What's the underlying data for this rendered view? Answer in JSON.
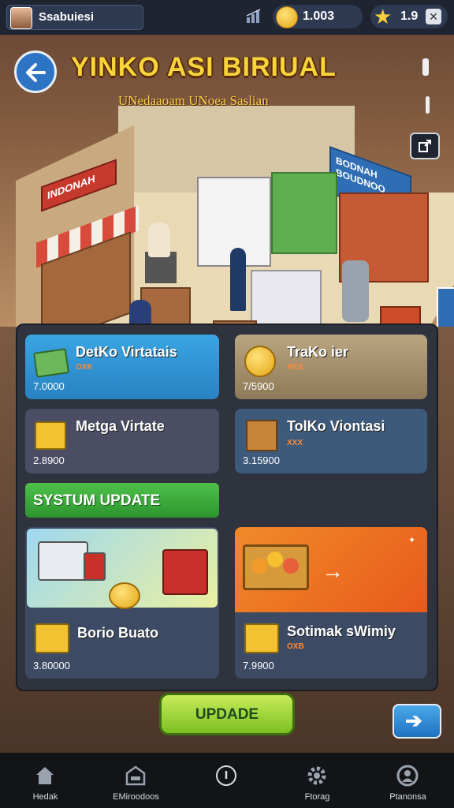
{
  "profile": {
    "name": "Ssabuiesi"
  },
  "resources": {
    "coins": "1.003",
    "stars": "1.9"
  },
  "title": "YINKO ASI BIRIUAL",
  "subtitle": "UNedaaoam UNoea Saslian",
  "scene_signs": {
    "left": "INDONAH",
    "right": "BODNAH BOUDNOO"
  },
  "cards": [
    {
      "title": "DetKo Virtatais",
      "tag": "OXK",
      "value": "7.0000"
    },
    {
      "title": "TraKo ier",
      "tag": "XKS",
      "value": "7/5900"
    },
    {
      "title": "Metga Virtate",
      "tag": "",
      "value": "2.8900"
    },
    {
      "title": "TolKo Viontasi",
      "tag": "XXX",
      "value": "3.15900"
    }
  ],
  "system_update": {
    "label": "SYSTUM UPDATE"
  },
  "big_cards": [
    {
      "title": "Borio Buato",
      "value": "3.80000"
    },
    {
      "title": "Sotimak sWimiy",
      "tag": "OXB",
      "value": "7.9900"
    }
  ],
  "update_button": {
    "label": "UPDADE"
  },
  "nav": [
    {
      "label": "Hedak",
      "icon": "home-icon"
    },
    {
      "label": "EMiroodoos",
      "icon": "store-icon"
    },
    {
      "label": "",
      "icon": "info-icon"
    },
    {
      "label": "Ftorag",
      "icon": "settings-icon"
    },
    {
      "label": "Ptanonsa",
      "icon": "profile-icon"
    }
  ],
  "colors": {
    "title": "#f7d53a",
    "accent_green": "#4ec04a",
    "accent_blue": "#2d74c4",
    "accent_orange": "#f08a2a"
  }
}
